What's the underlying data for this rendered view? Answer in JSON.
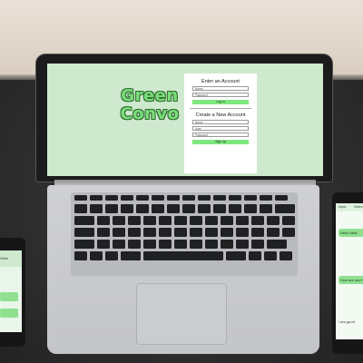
{
  "brand": {
    "line1": "Green",
    "line2": "Convo"
  },
  "login_form": {
    "title": "Enter an Account",
    "name_placeholder": "Name",
    "password_placeholder": "Password",
    "button_label": "Log in"
  },
  "signup_form": {
    "title": "Create a New Account",
    "name_placeholder": "Name",
    "user_placeholder": "User",
    "password_placeholder": "Password",
    "button_label": "Sign up"
  },
  "phone_right": {
    "tabs": [
      "Input",
      "Video"
    ],
    "messages": [
      "Hello Mila!",
      "How are you?"
    ],
    "partial_text": "I am good"
  },
  "phone_left": {
    "partial_text": "Hello"
  },
  "colors": {
    "screen_bg": "#cfe9cf",
    "accent": "#7ee87e",
    "brand_outline": "#2f6f2f"
  }
}
